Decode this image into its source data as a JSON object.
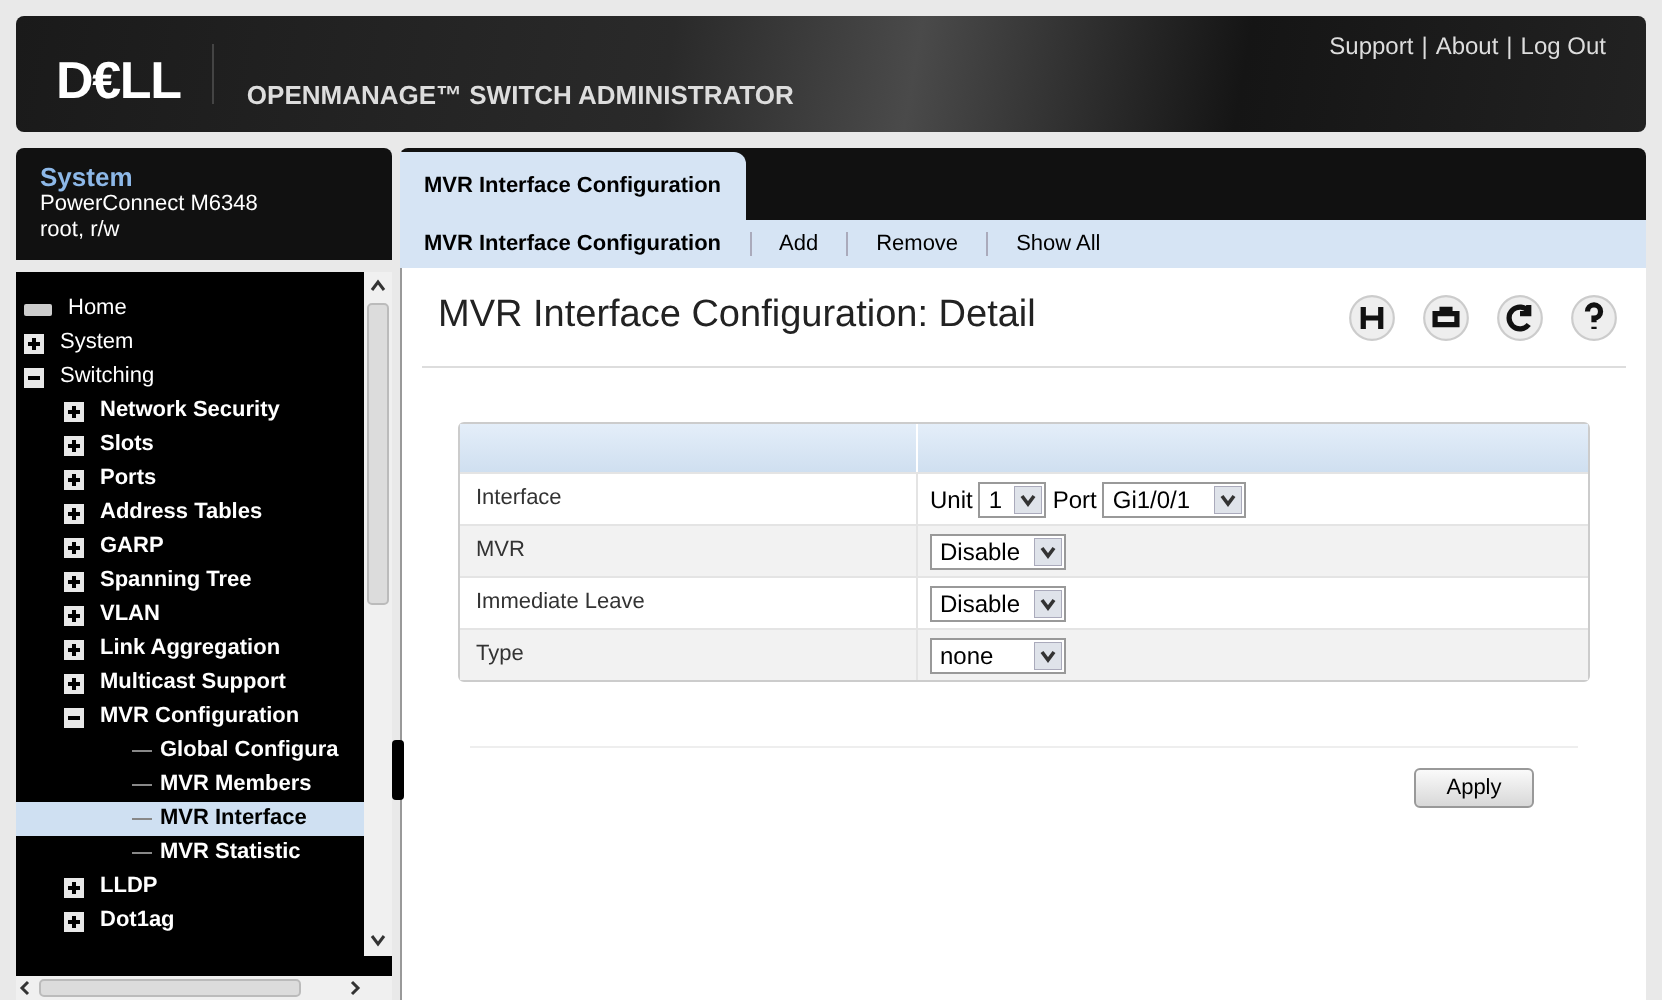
{
  "header": {
    "logo": "D€LL",
    "title": "OPENMANAGE™ SWITCH ADMINISTRATOR",
    "links": [
      "Support",
      "About",
      "Log Out"
    ],
    "separator": "|"
  },
  "system": {
    "title": "System",
    "model": "PowerConnect M6348",
    "user": "root, r/w"
  },
  "tree": [
    {
      "label": "Home",
      "kind": "home"
    },
    {
      "label": "System",
      "kind": "folder",
      "expanded": false
    },
    {
      "label": "Switching",
      "kind": "folder",
      "expanded": true,
      "children": [
        {
          "label": "Network Security",
          "kind": "folder",
          "expanded": false
        },
        {
          "label": "Slots",
          "kind": "folder",
          "expanded": false
        },
        {
          "label": "Ports",
          "kind": "folder",
          "expanded": false
        },
        {
          "label": "Address Tables",
          "kind": "folder",
          "expanded": false
        },
        {
          "label": "GARP",
          "kind": "folder",
          "expanded": false
        },
        {
          "label": "Spanning Tree",
          "kind": "folder",
          "expanded": false
        },
        {
          "label": "VLAN",
          "kind": "folder",
          "expanded": false
        },
        {
          "label": "Link Aggregation",
          "kind": "folder",
          "expanded": false
        },
        {
          "label": "Multicast Support",
          "kind": "folder",
          "expanded": false
        },
        {
          "label": "MVR Configuration",
          "kind": "folder",
          "expanded": true,
          "children": [
            {
              "label": "Global Configura",
              "kind": "leaf",
              "selected": false
            },
            {
              "label": "MVR Members",
              "kind": "leaf",
              "selected": false
            },
            {
              "label": "MVR Interface",
              "kind": "leaf",
              "selected": true
            },
            {
              "label": "MVR Statistic",
              "kind": "leaf",
              "selected": false
            }
          ]
        },
        {
          "label": "LLDP",
          "kind": "folder",
          "expanded": false
        },
        {
          "label": "Dot1ag",
          "kind": "folder",
          "expanded": false
        }
      ]
    }
  ],
  "tabs": [
    {
      "label": "MVR Interface Configuration",
      "selected": true
    }
  ],
  "subnav": [
    {
      "label": "MVR Interface Configuration",
      "selected": true
    },
    {
      "label": "Add",
      "selected": false
    },
    {
      "label": "Remove",
      "selected": false
    },
    {
      "label": "Show All",
      "selected": false
    }
  ],
  "page_title": "MVR Interface Configuration: Detail",
  "form": [
    {
      "label": "Interface",
      "kind": "interface",
      "unit_label": "Unit",
      "unit": "1",
      "port_label": "Port",
      "port": "Gi1/0/1"
    },
    {
      "label": "MVR",
      "kind": "select",
      "value": "Disable"
    },
    {
      "label": "Immediate Leave",
      "kind": "select",
      "value": "Disable"
    },
    {
      "label": "Type",
      "kind": "select",
      "value": "none"
    }
  ],
  "apply_button": "Apply"
}
